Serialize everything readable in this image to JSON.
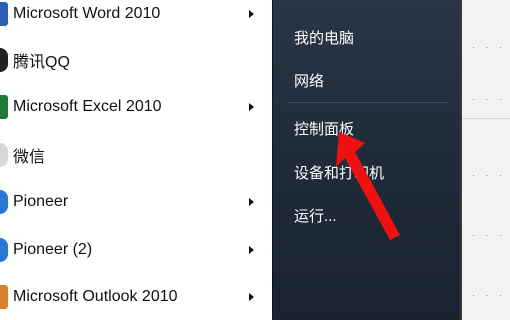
{
  "programs": [
    {
      "label": "Microsoft Word 2010",
      "icon": "word-icon",
      "has_submenu": true
    },
    {
      "label": "腾讯QQ",
      "icon": "qq-icon",
      "has_submenu": false
    },
    {
      "label": "Microsoft Excel 2010",
      "icon": "excel-icon",
      "has_submenu": true
    },
    {
      "label": "微信",
      "icon": "wechat-icon",
      "has_submenu": false
    },
    {
      "label": "Pioneer",
      "icon": "pioneer-icon",
      "has_submenu": true
    },
    {
      "label": "Pioneer (2)",
      "icon": "pioneer-icon",
      "has_submenu": true
    },
    {
      "label": "Microsoft Outlook 2010",
      "icon": "outlook-icon",
      "has_submenu": true
    }
  ],
  "right_pane": {
    "my_computer": "我的电脑",
    "network": "网络",
    "control_panel": "控制面板",
    "devices_and_printers": "设备和打印机",
    "run": "运行..."
  },
  "colors": {
    "left_bg": "#ffffff",
    "right_bg": "#243041",
    "annotation_arrow": "#ee1111"
  }
}
